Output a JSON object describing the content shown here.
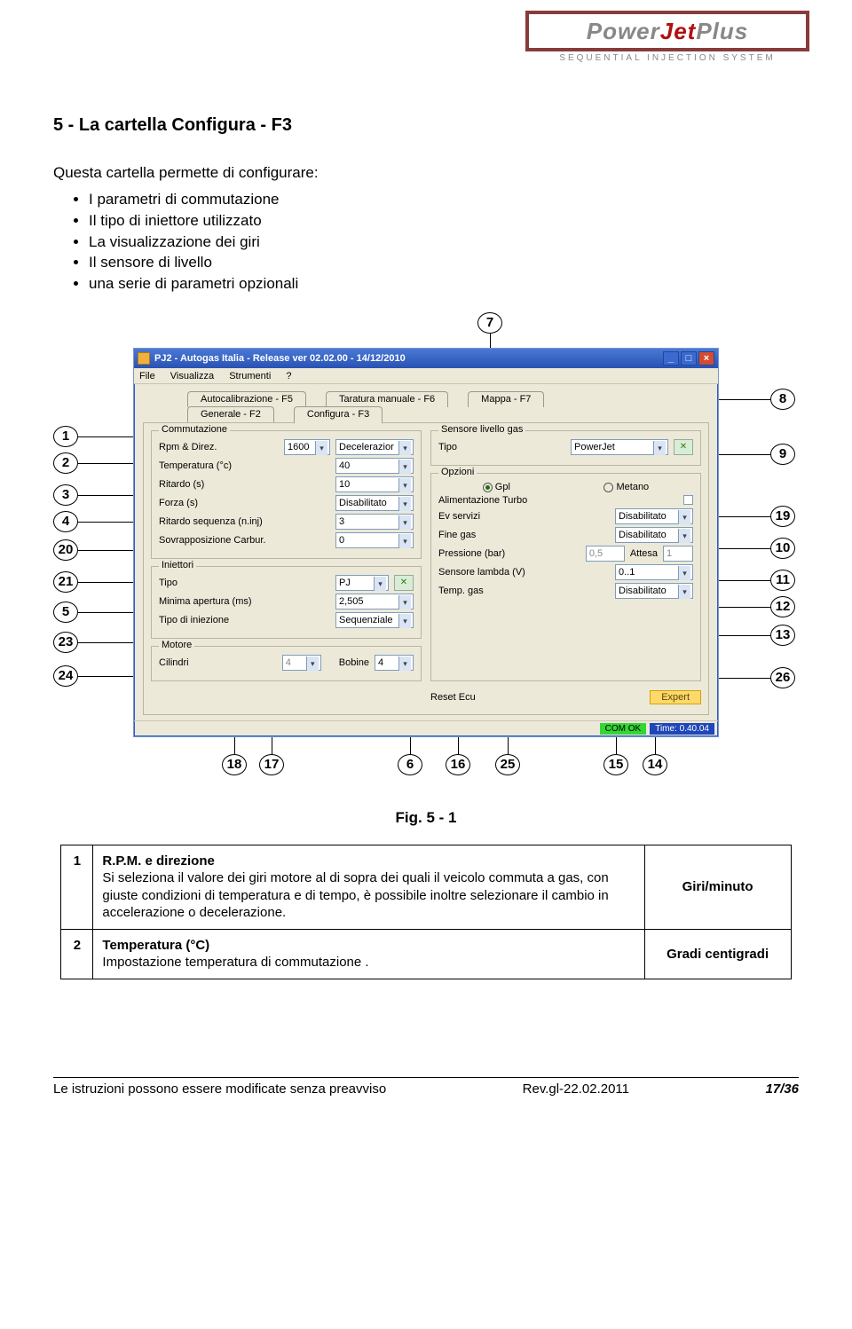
{
  "brand": {
    "name_a": "Power",
    "name_b": "Jet",
    "name_c": "Plus",
    "sub": "SEQUENTIAL INJECTION SYSTEM"
  },
  "section_title": "5 - La cartella Configura - F3",
  "intro": "Questa cartella permette di configurare:",
  "bullets": [
    "I parametri di commutazione",
    "Il tipo di iniettore utilizzato",
    "La visualizzazione dei giri",
    "Il sensore di livello",
    "una serie di parametri opzionali"
  ],
  "window": {
    "title": "PJ2 - Autogas Italia - Release  ver 02.02.00 - 14/12/2010",
    "menus": [
      "File",
      "Visualizza",
      "Strumenti",
      "?"
    ],
    "tabs_top": [
      "Autocalibrazione - F5",
      "Taratura manuale - F6",
      "Mappa - F7"
    ],
    "tabs_bottom": [
      "Generale - F2",
      "Configura - F3"
    ],
    "commutazione": {
      "legend": "Commutazione",
      "rpm_label": "Rpm & Direz.",
      "rpm_value": "1600",
      "rpm_mode": "Decelerazior",
      "temp_label": "Temperatura (°c)",
      "temp_value": "40",
      "ritardo_label": "Ritardo (s)",
      "ritardo_value": "10",
      "forza_label": "Forza (s)",
      "forza_value": "Disabilitato",
      "ritseq_label": "Ritardo sequenza (n.inj)",
      "ritseq_value": "3",
      "sovrap_label": "Sovrapposizione Carbur.",
      "sovrap_value": "0"
    },
    "iniettori": {
      "legend": "Iniettori",
      "tipo_label": "Tipo",
      "tipo_value": "PJ",
      "minap_label": "Minima apertura (ms)",
      "minap_value": "2,505",
      "tinj_label": "Tipo di iniezione",
      "tinj_value": "Sequenziale"
    },
    "motore": {
      "legend": "Motore",
      "cil_label": "Cilindri",
      "cil_value": "4",
      "bob_label": "Bobine",
      "bob_value": "4"
    },
    "sensore": {
      "legend": "Sensore livello gas",
      "tipo_label": "Tipo",
      "tipo_value": "PowerJet"
    },
    "opzioni": {
      "legend": "Opzioni",
      "gpl_label": "Gpl",
      "metano_label": "Metano",
      "turbo_label": "Alimentazione Turbo",
      "ev_label": "Ev servizi",
      "ev_value": "Disabilitato",
      "fine_label": "Fine gas",
      "fine_value": "Disabilitato",
      "press_label": "Pressione (bar)",
      "press_value": "0,5",
      "attesa_label": "Attesa",
      "attesa_value": "1",
      "lambda_label": "Sensore lambda (V)",
      "lambda_value": "0..1",
      "tgas_label": "Temp. gas",
      "tgas_value": "Disabilitato"
    },
    "reset_label": "Reset Ecu",
    "expert_label": "Expert",
    "status": {
      "com": "COM OK",
      "time": "Time: 0.40.04"
    }
  },
  "callouts_left": [
    "1",
    "2",
    "3",
    "4",
    "20",
    "21",
    "5",
    "23",
    "24"
  ],
  "callouts_right": [
    "8",
    "9",
    "19",
    "10",
    "11",
    "12",
    "13",
    "26"
  ],
  "callouts_top": [
    "7"
  ],
  "callouts_bottom": [
    "18",
    "17",
    "6",
    "16",
    "25",
    "15",
    "14"
  ],
  "fig_caption": "Fig. 5 - 1",
  "table_rows": [
    {
      "num": "1",
      "title": "R.P.M. e direzione",
      "body": "Si seleziona il valore dei giri motore al di sopra dei quali il veicolo commuta a gas, con giuste condizioni di temperatura e di tempo, è possibile inoltre selezionare il cambio in accelerazione o decelerazione.",
      "unit": "Giri/minuto"
    },
    {
      "num": "2",
      "title": "Temperatura (°C)",
      "body": "Impostazione  temperatura di commutazione .",
      "unit": "Gradi centigradi"
    }
  ],
  "footer": {
    "left": "Le istruzioni possono essere modificate senza preavviso",
    "mid": "Rev.gl-22.02.2011",
    "right": "17/36"
  }
}
